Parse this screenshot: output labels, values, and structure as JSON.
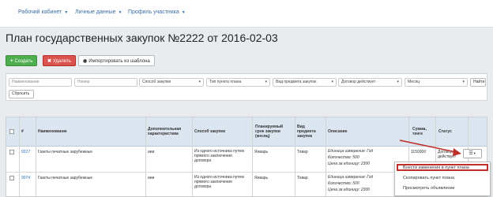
{
  "nav": {
    "items": [
      "Рабочий кабинет",
      "Личные данные",
      "Профиль участника"
    ]
  },
  "page": {
    "title": "План государственных закупок №2222 от 2016-02-03"
  },
  "toolbar": {
    "create_label": "Создать",
    "delete_label": "Удалить",
    "import_label": "Импортировать из шаблона"
  },
  "filters": {
    "name_placeholder": "Наименование",
    "number_placeholder": "Номер",
    "purchase_method": "Способ закупки",
    "plan_item_type": "Тип пункта плана",
    "subject_type": "Вид предмета закупок",
    "contract_valid": "Договор действует",
    "month": "Месяц",
    "find_label": "Найти",
    "reset_label": "Сбросить"
  },
  "table": {
    "headers": {
      "num": "#",
      "name": "Наименование",
      "extra": "Дополнительная характеристика",
      "method": "Способ закупки",
      "planned": "Планируемый срок закупки (месяц)",
      "subject": "Вид предмета закупок",
      "desc": "Описание",
      "sum": "Сумма, тенге",
      "status": "Статус"
    },
    "rows": [
      {
        "num": "9227",
        "name": "Газеты печатные зарубежные",
        "extra": "иии",
        "method": "Из одного источника путем прямого заключения договора",
        "planned": "Январь",
        "subject": "Товар",
        "unit": "Единица измерения: Год",
        "qty": "Количество: 500",
        "price": "Цена за единицу: 2300",
        "sum": "1150000",
        "status": "Договор действует"
      },
      {
        "num": "9074",
        "name": "Газеты печатные зарубежные",
        "extra": "иии",
        "method": "Из одного источника путем прямого заключения договора",
        "planned": "Январь",
        "subject": "Товар",
        "unit": "Единица измерения: Год",
        "qty": "Количество: 500",
        "price": "Цена за единицу: 2300",
        "sum": "",
        "status": ""
      }
    ]
  },
  "context_menu": {
    "items": [
      "Внести изменения в пункт плана",
      "Скопировать пункт плана",
      "Просмотреть объявление"
    ]
  },
  "colors": {
    "create_button": "#4cae4c",
    "delete_button": "#d9534f",
    "header_bg": "#dbe6f0",
    "highlight": "#c0302b",
    "annotation_arrow": "#c0302b"
  }
}
